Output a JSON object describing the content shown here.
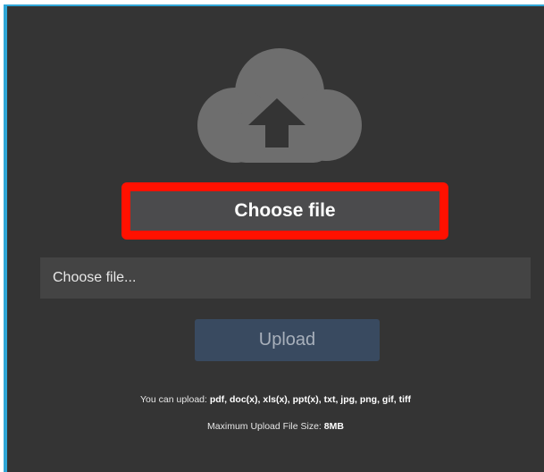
{
  "uploader": {
    "icon": "cloud-upload-icon",
    "choose_button_label": "Choose file",
    "file_field_placeholder": "Choose file...",
    "upload_button_label": "Upload",
    "allowed_types_prefix": "You can upload: ",
    "allowed_types": "pdf, doc(x), xls(x), ppt(x), txt, jpg, png, gif, tiff",
    "max_size_prefix": "Maximum Upload File Size: ",
    "max_size": "8MB"
  },
  "colors": {
    "background": "#343434",
    "frame_border": "#2fa6d6",
    "highlight": "#ff1100",
    "choose_button": "#4b4b4d",
    "upload_button": "#394a60",
    "cloud": "#6e6e6e"
  }
}
